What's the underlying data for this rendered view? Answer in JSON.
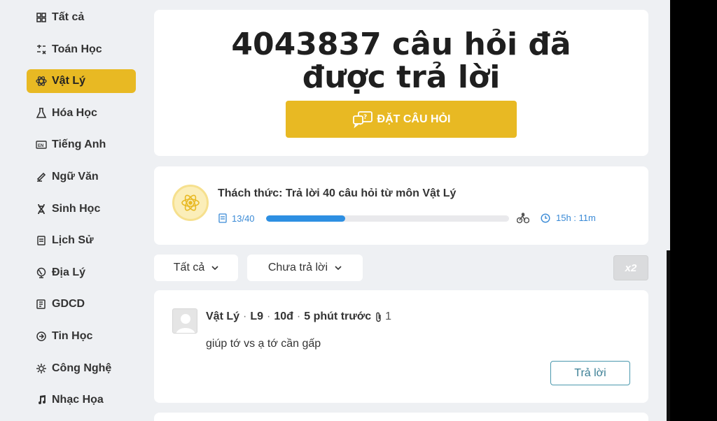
{
  "sidebar": {
    "items": [
      {
        "label": "Tất cả",
        "icon": "grid-icon",
        "active": false
      },
      {
        "label": "Toán Học",
        "icon": "math-icon",
        "active": false
      },
      {
        "label": "Vật Lý",
        "icon": "atom-icon",
        "active": true
      },
      {
        "label": "Hóa Học",
        "icon": "flask-icon",
        "active": false
      },
      {
        "label": "Tiếng Anh",
        "icon": "english-icon",
        "active": false
      },
      {
        "label": "Ngữ Văn",
        "icon": "writing-icon",
        "active": false
      },
      {
        "label": "Sinh Học",
        "icon": "dna-icon",
        "active": false
      },
      {
        "label": "Lịch Sử",
        "icon": "scroll-icon",
        "active": false
      },
      {
        "label": "Địa Lý",
        "icon": "globe-icon",
        "active": false
      },
      {
        "label": "GDCD",
        "icon": "book-icon",
        "active": false
      },
      {
        "label": "Tin Học",
        "icon": "cpu-icon",
        "active": false
      },
      {
        "label": "Công Nghệ",
        "icon": "gear-icon",
        "active": false
      },
      {
        "label": "Nhạc Họa",
        "icon": "music-icon",
        "active": false
      }
    ]
  },
  "hero": {
    "title": "4043837 câu hỏi đã được trả lời",
    "ask_button": "ĐẶT CÂU HỎI"
  },
  "challenge": {
    "title": "Thách thức: Trả lời 40 câu hỏi  từ môn Vật Lý",
    "progress_text": "13/40",
    "progress_fraction": 0.325,
    "timer": "15h : 11m"
  },
  "filters": {
    "all": "Tất cả",
    "unanswered": "Chưa trả lời",
    "x2": "x2"
  },
  "question": {
    "subject": "Vật Lý",
    "grade": "L9",
    "points": "10đ",
    "time": "5 phút trước",
    "attachments": "1",
    "text": "giúp tớ vs ạ tớ cần gấp",
    "answer_button": "Trả lời"
  },
  "colors": {
    "accent": "#e8b923",
    "progress": "#2d8fe2",
    "link": "#3a8ad6",
    "background": "#eef0f3"
  }
}
